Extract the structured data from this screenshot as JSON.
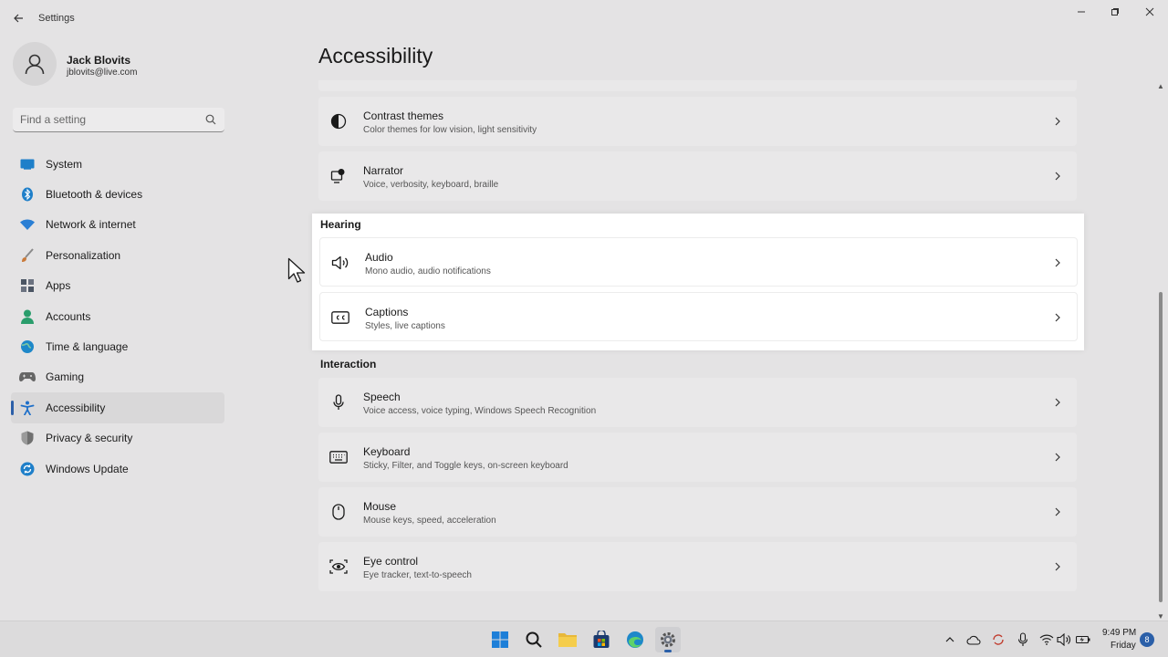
{
  "window": {
    "title": "Settings",
    "back_icon": "arrow-left-icon",
    "controls": [
      "minimize-icon",
      "maximize-icon",
      "close-icon"
    ]
  },
  "profile": {
    "name": "Jack Blovits",
    "email": "jblovits@live.com"
  },
  "search": {
    "placeholder": "Find a setting",
    "value": ""
  },
  "sidebar": {
    "items": [
      {
        "label": "System",
        "icon": "system-icon",
        "color": "#1e7fc9"
      },
      {
        "label": "Bluetooth & devices",
        "icon": "bluetooth-icon",
        "color": "#1e7fc9"
      },
      {
        "label": "Network & internet",
        "icon": "wifi-icon",
        "color": "#2a7fd4"
      },
      {
        "label": "Personalization",
        "icon": "brush-icon",
        "color": "#c97a3a"
      },
      {
        "label": "Apps",
        "icon": "apps-icon",
        "color": "#4b5563"
      },
      {
        "label": "Accounts",
        "icon": "accounts-icon",
        "color": "#2a9d6c"
      },
      {
        "label": "Time & language",
        "icon": "globe-icon",
        "color": "#1e88c9"
      },
      {
        "label": "Gaming",
        "icon": "gamepad-icon",
        "color": "#666666"
      },
      {
        "label": "Accessibility",
        "icon": "accessibility-icon",
        "color": "#1e6fc9",
        "active": true
      },
      {
        "label": "Privacy & security",
        "icon": "shield-icon",
        "color": "#707070"
      },
      {
        "label": "Windows Update",
        "icon": "update-icon",
        "color": "#1e7fc9"
      }
    ]
  },
  "main": {
    "title": "Accessibility",
    "vision_cards": [
      {
        "title": "Contrast themes",
        "subtitle": "Color themes for low vision, light sensitivity",
        "icon": "contrast-icon"
      },
      {
        "title": "Narrator",
        "subtitle": "Voice, verbosity, keyboard, braille",
        "icon": "narrator-icon"
      }
    ],
    "hearing": {
      "label": "Hearing",
      "cards": [
        {
          "title": "Audio",
          "subtitle": "Mono audio, audio notifications",
          "icon": "speaker-icon"
        },
        {
          "title": "Captions",
          "subtitle": "Styles, live captions",
          "icon": "captions-icon"
        }
      ]
    },
    "interaction": {
      "label": "Interaction",
      "cards": [
        {
          "title": "Speech",
          "subtitle": "Voice access, voice typing, Windows Speech Recognition",
          "icon": "microphone-icon"
        },
        {
          "title": "Keyboard",
          "subtitle": "Sticky, Filter, and Toggle keys, on-screen keyboard",
          "icon": "keyboard-icon"
        },
        {
          "title": "Mouse",
          "subtitle": "Mouse keys, speed, acceleration",
          "icon": "mouse-icon"
        },
        {
          "title": "Eye control",
          "subtitle": "Eye tracker, text-to-speech",
          "icon": "eye-control-icon"
        }
      ]
    }
  },
  "taskbar": {
    "apps": [
      "windows-start-icon",
      "search-icon",
      "file-explorer-icon",
      "store-icon",
      "edge-icon",
      "settings-gear-icon"
    ],
    "tray": [
      "chevron-up-icon",
      "onedrive-icon",
      "sync-icon",
      "microphone-icon",
      "wifi-icon",
      "volume-icon",
      "battery-icon"
    ],
    "time": "9:49 PM",
    "day": "Friday",
    "notification_count": "8"
  },
  "colors": {
    "accent": "#2b5fa8",
    "window_bg": "#e4e3e4",
    "card_bg": "#e9e8e9",
    "highlight_bg": "#ffffff"
  }
}
